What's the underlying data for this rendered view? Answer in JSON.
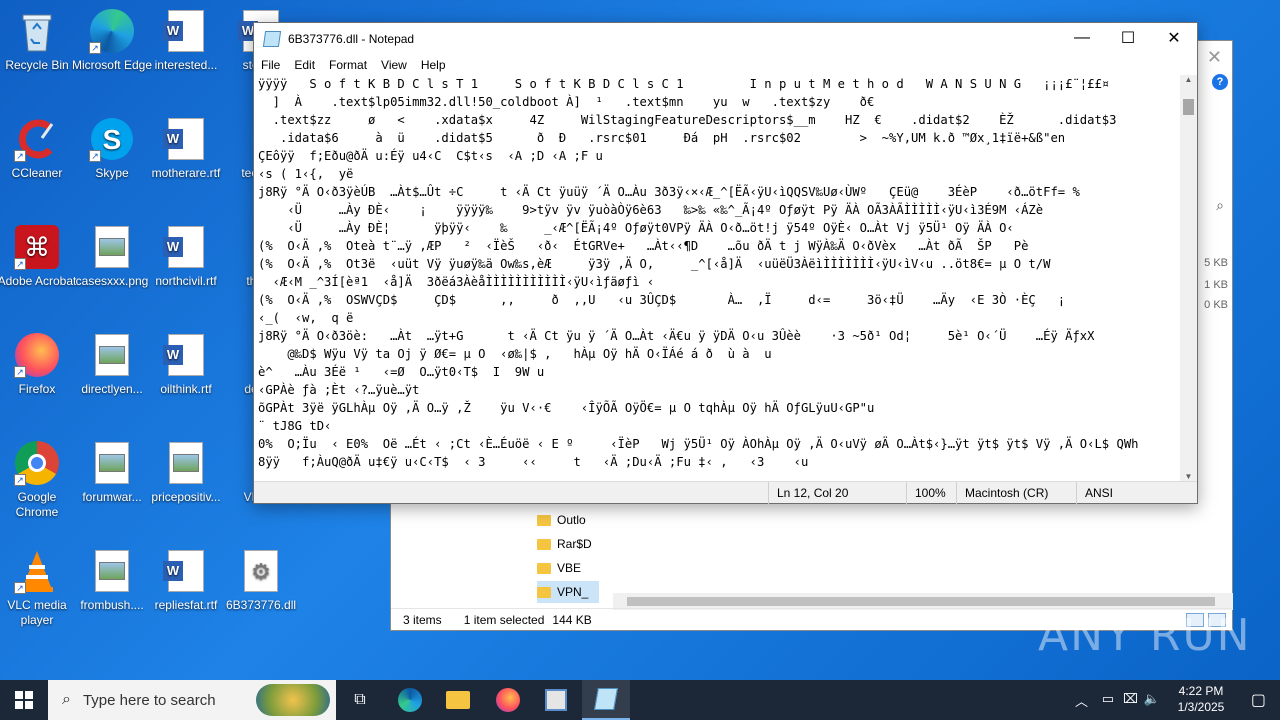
{
  "desktop": {
    "icons": [
      {
        "label": "Recycle Bin"
      },
      {
        "label": "Microsoft Edge"
      },
      {
        "label": "interested..."
      },
      {
        "label": "store..."
      },
      {
        "label": "CCleaner"
      },
      {
        "label": "Skype"
      },
      {
        "label": "motherare.rtf"
      },
      {
        "label": "techn..."
      },
      {
        "label": "Adobe Acrobat"
      },
      {
        "label": "casesxxx.png"
      },
      {
        "label": "northcivil.rtf"
      },
      {
        "label": "thin..."
      },
      {
        "label": "Firefox"
      },
      {
        "label": "directlyen..."
      },
      {
        "label": "oilthink.rtf"
      },
      {
        "label": "dete..."
      },
      {
        "label": "Google Chrome"
      },
      {
        "label": "forumwar..."
      },
      {
        "label": "pricepositiv..."
      },
      {
        "label": "VPN..."
      },
      {
        "label": "VLC media player"
      },
      {
        "label": "frombush...."
      },
      {
        "label": "repliesfat.rtf"
      },
      {
        "label": "6B373776.dll"
      }
    ]
  },
  "explorer": {
    "close_glyph": "✕",
    "help_glyph": "?",
    "sizes": [
      "5 KB",
      "1 KB",
      "0 KB"
    ],
    "tree": [
      "Outlo",
      "Rar$D",
      "VBE",
      "VPN_"
    ],
    "status": {
      "items": "3 items",
      "selected": "1 item selected",
      "size": "144 KB"
    }
  },
  "notepad": {
    "title": "6B373776.dll - Notepad",
    "menu": [
      "File",
      "Edit",
      "Format",
      "View",
      "Help"
    ],
    "controls": {
      "minimize": "—",
      "maximize": "☐",
      "close": "✕"
    },
    "lines": [
      "ÿÿÿÿ   S o f t K B D C l s T 1     S o f t K B D C l s C 1         I n p u t M e t h o d   W A N S U N G   ¡¡¡£¨¦££¤",
      "  ]  À    .text$lp05imm32.dll!50_coldboot À]  ¹   .text$mn    yu  w   .text$zy    ð€   ",
      "  .text$zz     ø   <    .xdata$x     4Z     WilStagingFeatureDescriptors$__m    HZ  €    .didat$2    ÈŽ      .didat$3",
      "   .idata$6     à  ü    .didat$5      ð  Ð   .rsrc$01     Ðá  pH  .rsrc$02        >  ~%Y,UM k.ð ™Øx¸1‡ïë+&ß\"en ",
      "ÇEôÿÿ  f;Eðu@ðÄ u:Éÿ u4‹C  C$t‹s  ‹A ;D ‹A ;F u",
      "‹s ( 1‹{,  yë",
      "j8Rÿ °Ä O‹ð3ÿèÚB  …Àt$…Ût ÷C     t ‹Ä Ct ÿuüÿ ´Ä O…Àu 3ð3ÿ‹×‹Æ_^[ËÃ‹ÿU‹ìQQSV‰Uø‹ÙWº   ÇEü@    3ÉèP    ‹ð…ötFf= %",
      "    ‹Ü     …Ày ÐÈ‹    ¡    ÿÿÿÿ‰    9>tÿv ÿv ÿuòàÒÿ6è63   ‰>‰­ «‰­^_Ã¡4º Oƒøÿt Pÿ ÄÀ OÃ3ÀÃÌÌÌÌÌ‹ÿU‹ì3É9M ‹ÁZè",
      "    ‹Ü     …Ày ÐÈ¦      ÿþÿÿ‹    ‰     _‹Æ^[ËÃ¡4º Oƒøÿt0VPÿ ÄÀ O‹ð…öt!j ÿ54º OÿÈ‹ O…Àt Vj ÿ5Ü¹ Oÿ ÄÀ O‹",
      "(%  O‹Ä ,%  Oteà t¨…ÿ ,ÆP   ²  ‹ÏèŠ   ‹ð‹  ÉtGRVe+   …Àt‹‹¶D    …õu ðÄ t j WÿÀ‰Ä O‹ðVèx   …Àt ðÃ  ŠP   Pè",
      "(%  O‹Ä ,%  Ot3ë  ‹uüt Vÿ ÿuøÿ‰ä Ow‰s,èÆ     ÿ3ÿ ,Ä O,     _^[‹å]Ä  ‹uüëÜ3ÀëìÌÌÌÌÌÌÌ‹ÿU‹ìV‹u ..öt8€= µ O t/W",
      "  ‹Æ‹M _^3Í[èª1  ‹å]Ä  3ðëá3ÀèåÌÌÌÌÌÌÌÌÌÌÌ‹ÿU‹ìƒäøƒì ‹",
      "(%  O‹Ä ,%  OSWVÇD$     ÇD$      ,‚     ð  ,,U   ‹u 3ÛÇD$       À…  ,Ï     d‹=     3ö‹‡Ü    …Äy  ‹E 3Ò ·ÈÇ   ¡",
      "‹_(  ‹w,  q ë",
      "j8Rÿ °Ä O‹ð3öè:   …Àt  …ÿt+G      t ‹Ä Ct ÿu ÿ ´Ä O…Àt ‹Ä€u ÿ ÿDÄ O‹u 3Ûèè    ·3 ~5ð¹ Od¦     5è¹ O‹´Ü    …Éÿ ÄƒxX",
      "    @‰D$ Wÿu Vÿ ta Oj ÿ Ø€= µ O  ‹ø‰|$ ,   hÀµ Oÿ hÄ O‹ÏÁé á ð  ù à  u",
      "è^   …Àu 3Éë ¹   ‹=Ø  O…ÿt0‹T$  I  9W u",
      "‹GPÀè ƒà ;Èt ‹?…ÿuè…ÿt",
      "õGPÀt 3ÿë ÿGLhÀµ Oÿ ‚Ä O…ÿ ,Ž    ÿu V‹·€    ‹ÎÿÕÃ OÿÖ€= µ O tqhÀµ Oÿ hÄ OƒGLÿuU‹GP\"u",
      "¨ tJ8G tD‹",
      "0%  O;Ïu  ‹ E0%  Oë …Ét ‹ ;Ct ‹È…Éuöë ‹ E º     ‹ÏèP   Wj ÿ5Ü¹ Oÿ ÀOhÀµ Oÿ ‚Ä O‹uVÿ øÄ O…Àt$‹}…ÿt ÿt$ ÿt$ Vÿ ,Ä O‹L$ QWh",
      "8ÿÿ   f;ÀuQ@ðÄ u‡€ÿ u‹C‹T$  ‹ 3     ‹‹     t   ‹Ä ;Du‹Ä ;Fu ‡‹ ,   ‹3    ‹u  "
    ],
    "status": {
      "position": "Ln 12, Col 20",
      "zoom": "100%",
      "line_ending": "Macintosh (CR)",
      "encoding": "ANSI"
    }
  },
  "taskbar": {
    "search_placeholder": "Type here to search",
    "clock_time": "4:22 PM",
    "clock_date": "1/3/2025"
  },
  "watermark": "ANY RUN"
}
